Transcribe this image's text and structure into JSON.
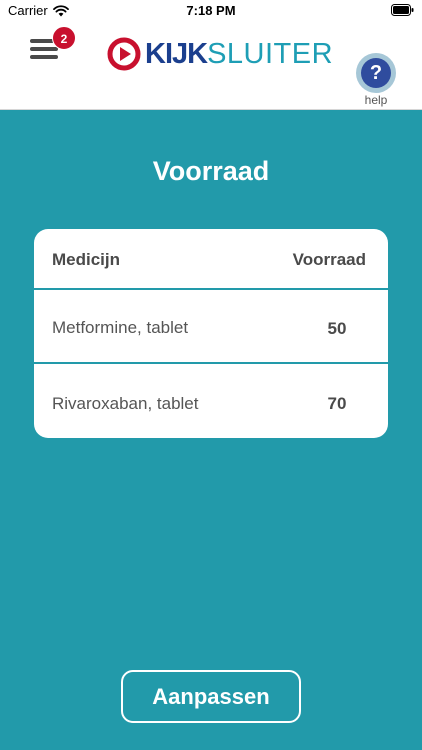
{
  "status_bar": {
    "carrier": "Carrier",
    "time": "7:18 PM"
  },
  "header": {
    "menu_badge_count": "2",
    "logo_kijk": "KIJK",
    "logo_sluiter": "SLUITER",
    "help_symbol": "?",
    "help_label": "help",
    "icons": {
      "menu": "hamburger-menu-icon",
      "logo": "play-circle-icon",
      "help": "question-mark-icon"
    }
  },
  "page": {
    "title": "Voorraad"
  },
  "table": {
    "columns": [
      "Medicijn",
      "Voorraad"
    ],
    "rows": [
      {
        "medicine": "Metformine, tablet",
        "stock": "50"
      },
      {
        "medicine": "Rivaroxaban, tablet",
        "stock": "70"
      }
    ]
  },
  "actions": {
    "adjust_label": "Aanpassen"
  },
  "colors": {
    "background": "#229aaa",
    "badge": "#c8102e",
    "logo_blue": "#1b3f8e",
    "logo_teal": "#1e9eb5",
    "help_blue": "#2f4c9e"
  }
}
